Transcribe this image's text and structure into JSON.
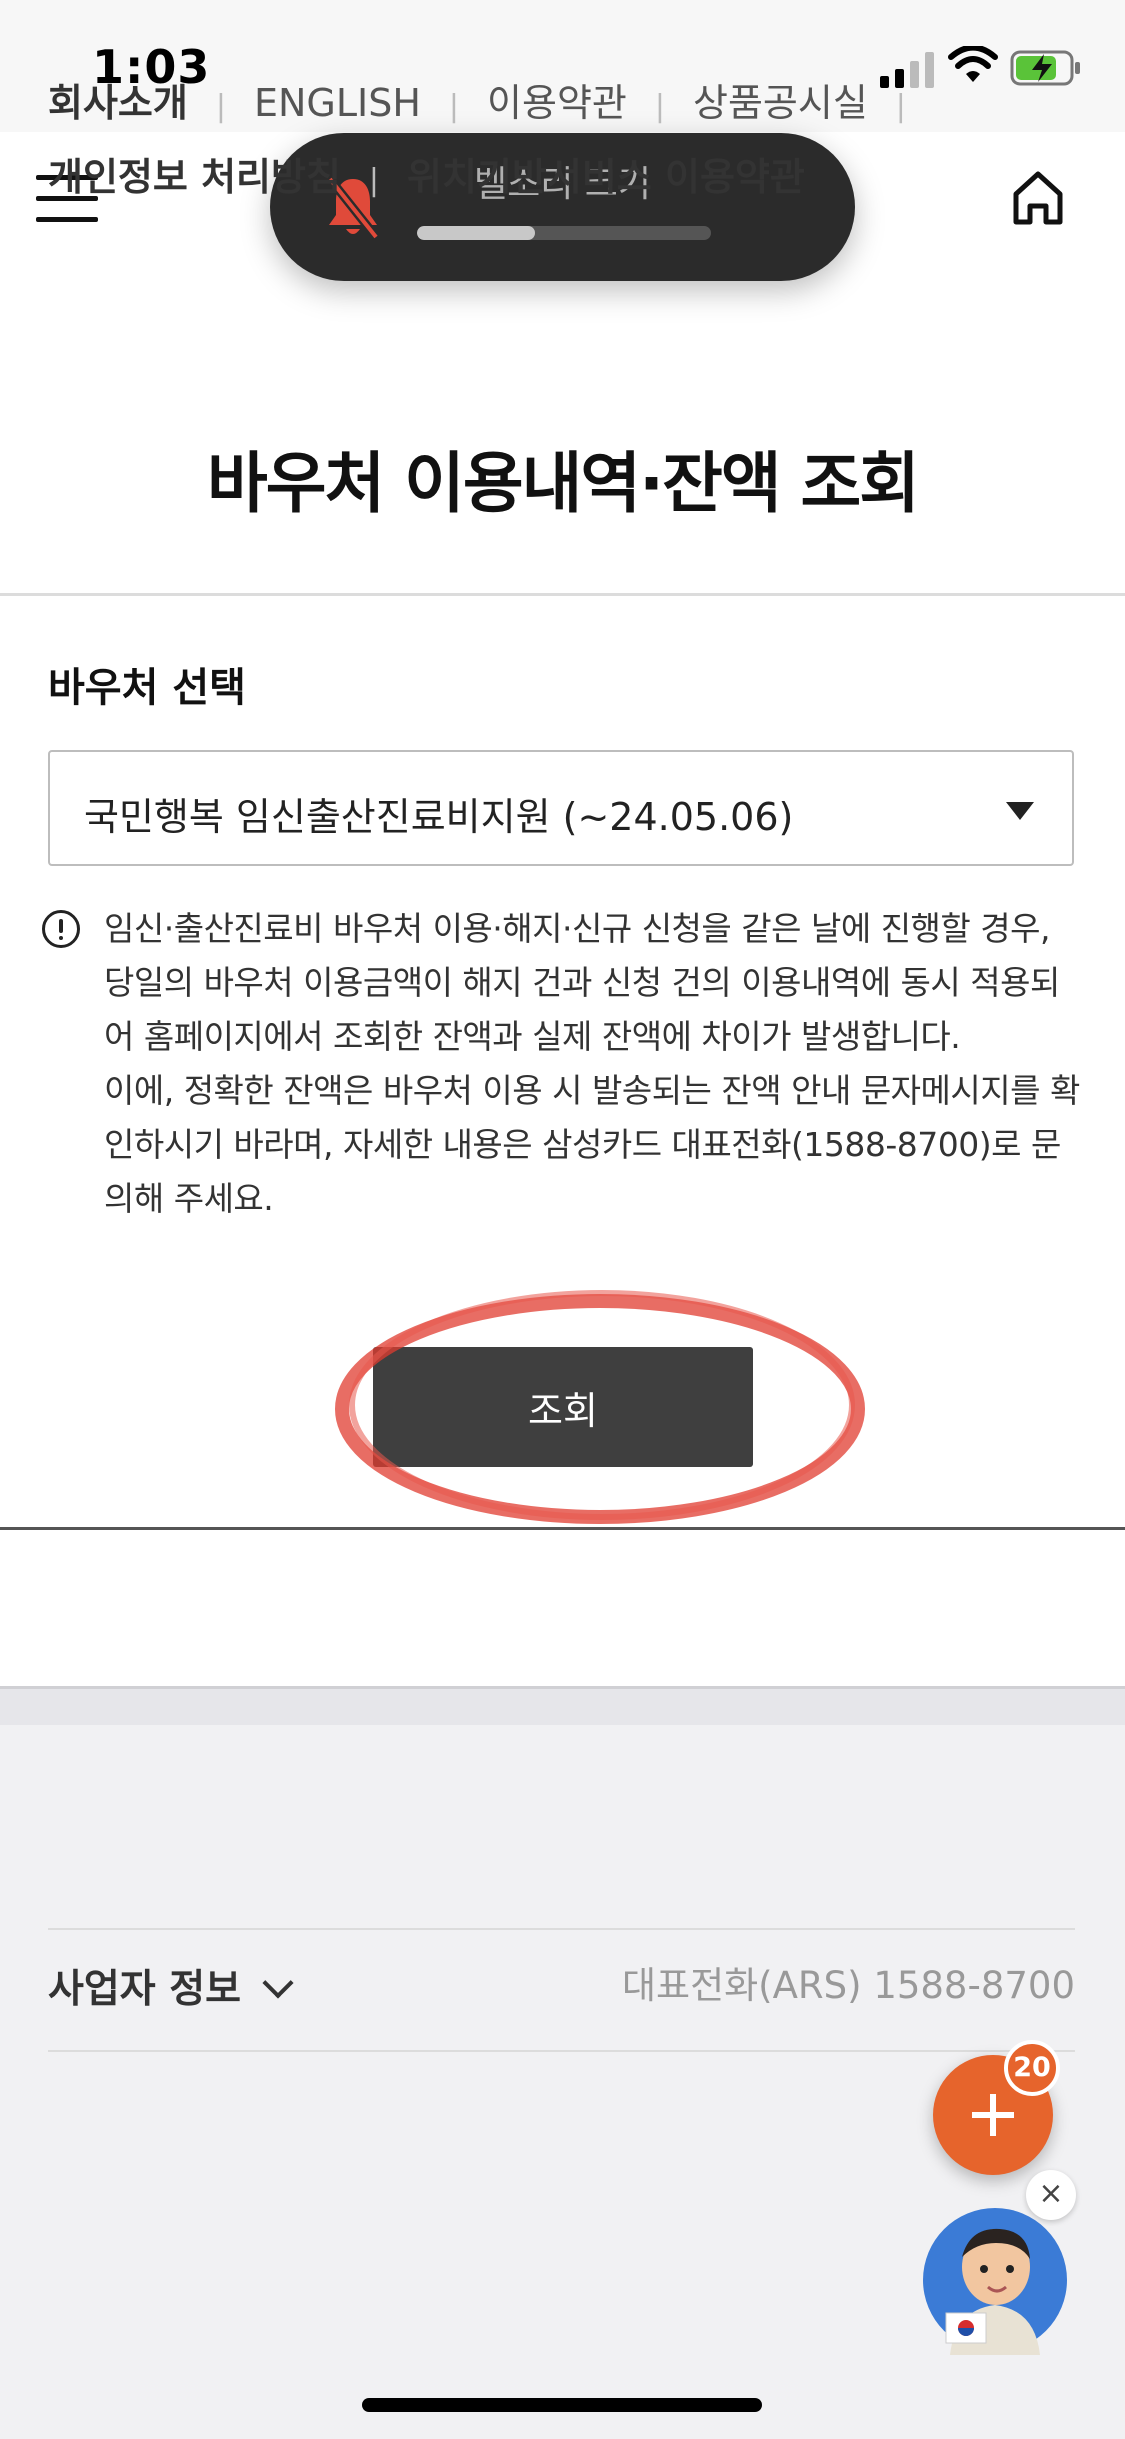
{
  "status_bar": {
    "time": "1:03"
  },
  "header": {
    "title": "바우처 이용내역·잔액 조회"
  },
  "volume_hud": {
    "label": "벨소리 크기",
    "level": 0.4
  },
  "voucher": {
    "section_label": "바우처 선택",
    "selected": "국민행복 임신출산진료비지원 (~24.05.06)"
  },
  "notice": {
    "paragraph1": "임신·출산진료비 바우처 이용·해지·신규 신청을 같은 날에 진행할 경우, 당일의 바우처 이용금액이 해지 건과 신청 건의 이용내역에 동시 적용되어 홈페이지에서 조회한 잔액과 실제 잔액에 차이가 발생합니다.",
    "paragraph2": "이에, 정확한 잔액은 바우처 이용 시 발송되는 잔액 안내 문자메시지를 확인하시기 바라며, 자세한 내용은 삼성카드 대표전화(1588-8700)로 문의해 주세요."
  },
  "query_button": {
    "label": "조회"
  },
  "footer": {
    "links": [
      "회사소개",
      "ENGLISH",
      "이용약관",
      "상품공시실",
      "개인정보 처리방침",
      "위치기반서비스 이용약관"
    ],
    "business_info": "사업자 정보",
    "phone": "대표전화(ARS) 1588-8700"
  },
  "fab": {
    "badge": "20"
  },
  "colors": {
    "accent": "#e6642c",
    "button_dark": "#3f3f3f",
    "annotation": "#e03c30"
  }
}
